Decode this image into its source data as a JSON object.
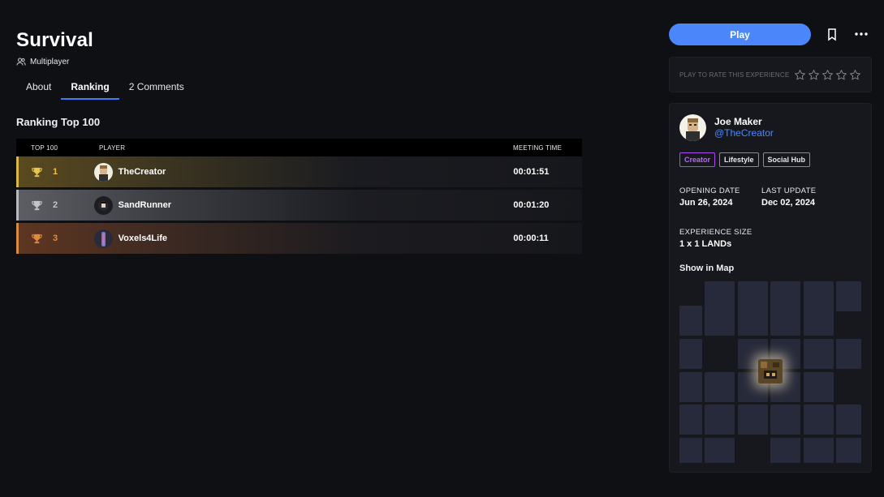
{
  "experience": {
    "title": "Survival",
    "mode": "Multiplayer"
  },
  "tabs": [
    {
      "label": "About",
      "active": false
    },
    {
      "label": "Ranking",
      "active": true
    },
    {
      "label": "2 Comments",
      "active": false
    }
  ],
  "ranking": {
    "title": "Ranking Top 100",
    "columns": {
      "rank": "TOP 100",
      "player": "PLAYER",
      "time": "MEETING TIME"
    },
    "rows": [
      {
        "rank": "1",
        "player": "TheCreator",
        "time": "00:01:51",
        "trophy": "gold-trophy-icon"
      },
      {
        "rank": "2",
        "player": "SandRunner",
        "time": "00:01:20",
        "trophy": "silver-trophy-icon"
      },
      {
        "rank": "3",
        "player": "Voxels4Life",
        "time": "00:00:11",
        "trophy": "bronze-trophy-icon"
      }
    ]
  },
  "actions": {
    "play_label": "Play",
    "rate_label": "PLAY TO RATE THIS EXPERIENCE",
    "rating_max": 5,
    "rating_value": 0
  },
  "creator": {
    "name": "Joe Maker",
    "handle": "@TheCreator",
    "tags": [
      "Creator",
      "Lifestyle",
      "Social Hub"
    ]
  },
  "details": {
    "opening_label": "OPENING DATE",
    "opening_value": "Jun 26, 2024",
    "update_label": "LAST UPDATE",
    "update_value": "Dec 02, 2024",
    "size_label": "EXPERIENCE SIZE",
    "size_value": "1 x 1 LANDs",
    "map_label": "Show in Map"
  },
  "colors": {
    "accent": "#4b86fb",
    "gold": "#d8b84a",
    "silver": "#b8b9bf",
    "bronze": "#d98a45",
    "creator_tag": "#a84ae8"
  }
}
